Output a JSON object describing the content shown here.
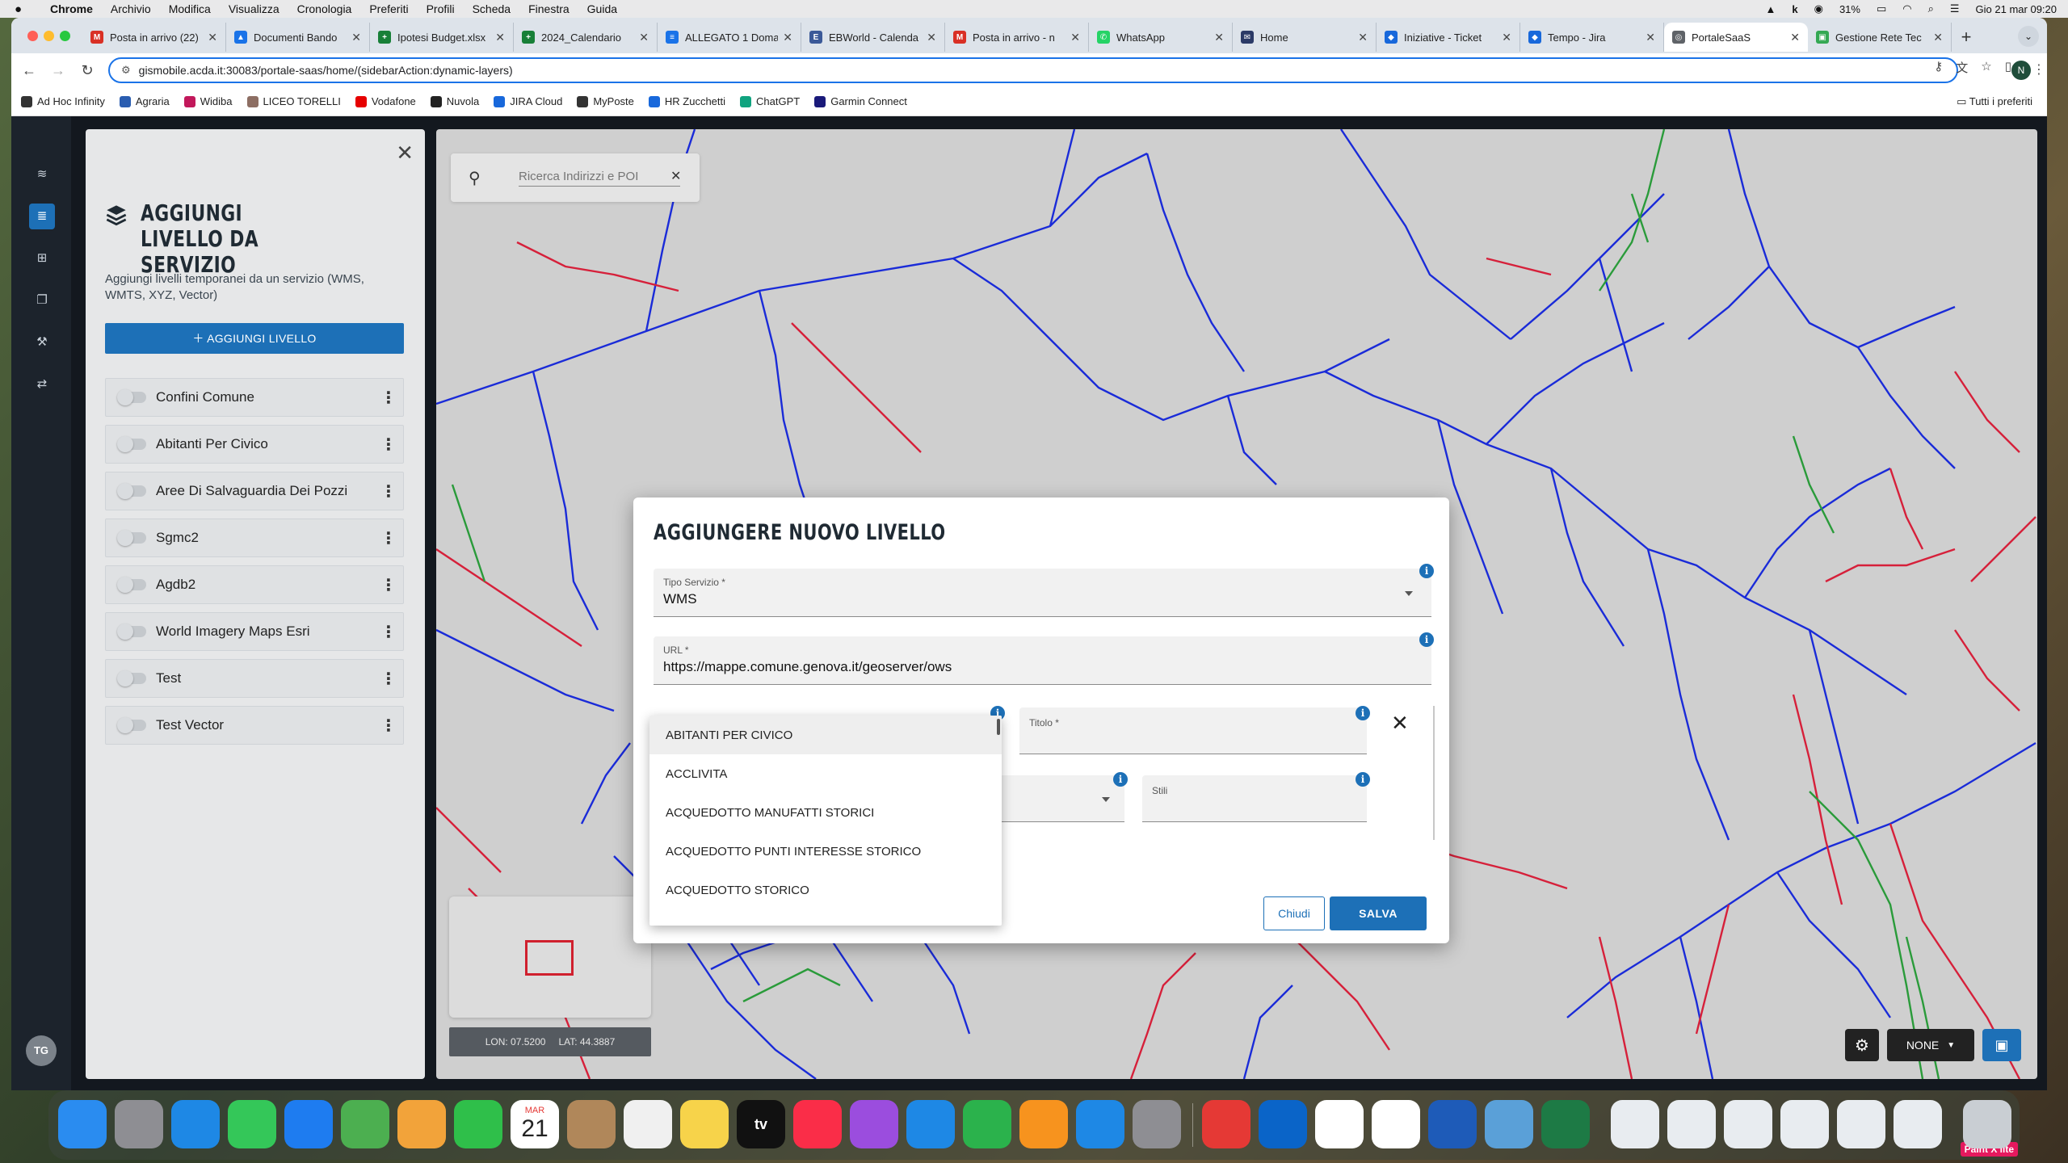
{
  "mac_menubar": {
    "app": "Chrome",
    "items": [
      "Archivio",
      "Modifica",
      "Visualizza",
      "Cronologia",
      "Preferiti",
      "Profili",
      "Scheda",
      "Finestra",
      "Guida"
    ],
    "battery": "31%",
    "datetime": "Gio 21 mar  09:20"
  },
  "browser": {
    "tabs": [
      {
        "title": "Posta in arrivo (22)",
        "color": "#d93025",
        "letter": "M"
      },
      {
        "title": "Documenti Bando",
        "color": "#1a73e8",
        "letter": "▲"
      },
      {
        "title": "Ipotesi Budget.xlsx",
        "color": "#188038",
        "letter": "+"
      },
      {
        "title": "2024_Calendario",
        "color": "#188038",
        "letter": "+"
      },
      {
        "title": "ALLEGATO 1 Doma",
        "color": "#1a73e8",
        "letter": "≡"
      },
      {
        "title": "EBWorld - Calenda",
        "color": "#3b5998",
        "letter": "E"
      },
      {
        "title": "Posta in arrivo - n",
        "color": "#d93025",
        "letter": "M"
      },
      {
        "title": "WhatsApp",
        "color": "#25d366",
        "letter": "✆"
      },
      {
        "title": "Home",
        "color": "#2b3a67",
        "letter": "✉"
      },
      {
        "title": "Iniziative - Ticket",
        "color": "#1868db",
        "letter": "◆"
      },
      {
        "title": "Tempo - Jira",
        "color": "#1868db",
        "letter": "◆"
      },
      {
        "title": "PortaleSaaS",
        "color": "#5f6368",
        "letter": "◎"
      },
      {
        "title": "Gestione Rete Tec",
        "color": "#34a853",
        "letter": "▣"
      }
    ],
    "active_tab_index": 11,
    "url": "gismobile.acda.it:30083/portale-saas/home/(sidebarAction:dynamic-layers)",
    "profile_initial": "N",
    "bookmarks": [
      {
        "label": "Ad Hoc Infinity",
        "color": "#333"
      },
      {
        "label": "Agraria",
        "color": "#2a5db0"
      },
      {
        "label": "Widiba",
        "color": "#c2185b"
      },
      {
        "label": "LICEO TORELLI",
        "color": "#8d6e63"
      },
      {
        "label": "Vodafone",
        "color": "#e60000"
      },
      {
        "label": "Nuvola",
        "color": "#222"
      },
      {
        "label": "JIRA Cloud",
        "color": "#1868db"
      },
      {
        "label": "MyPoste",
        "color": "#333"
      },
      {
        "label": "HR Zucchetti",
        "color": "#1868db"
      },
      {
        "label": "ChatGPT",
        "color": "#10a37f"
      },
      {
        "label": "Garmin Connect",
        "color": "#1a1a7a"
      }
    ],
    "all_bookmarks": "Tutti i preferiti"
  },
  "app": {
    "rail_icons": [
      "layers-outline-icon",
      "layers-icon",
      "grid-icon",
      "copy-icon",
      "wrench-icon",
      "route-icon"
    ],
    "user_initials": "TG",
    "panel": {
      "title": "AGGIUNGI LIVELLO DA SERVIZIO",
      "description": "Aggiungi livelli temporanei da un servizio (WMS, WMTS, XYZ, Vector)",
      "add_button": "AGGIUNGI LIVELLO",
      "layers": [
        "Confini Comune",
        "Abitanti Per Civico",
        "Aree Di Salvaguardia Dei Pozzi",
        "Sgmc2",
        "Agdb2",
        "World Imagery Maps Esri",
        "Test",
        "Test Vector"
      ]
    },
    "map": {
      "search_placeholder": "Ricerca Indirizzi e POI",
      "lon": "LON: 07.5200",
      "lat": "LAT: 44.3887",
      "basemap": "NONE"
    },
    "modal": {
      "title": "AGGIUNGERE NUOVO LIVELLO",
      "service_type_label": "Tipo Servizio *",
      "service_type_value": "WMS",
      "url_label": "URL *",
      "url_value": "https://mappe.comune.genova.it/geoserver/ows",
      "title_label": "Titolo *",
      "styles_label": "Stili",
      "close_button": "Chiudi",
      "save_button": "SALVA",
      "dropdown_options": [
        "ABITANTI PER CIVICO",
        "ACCLIVITA",
        "ACQUEDOTTO MANUFATTI STORICI",
        "ACQUEDOTTO PUNTI INTERESSE STORICO",
        "ACQUEDOTTO STORICO"
      ]
    }
  },
  "dock": {
    "apps": [
      {
        "name": "finder-icon",
        "color": "#2a8cf0"
      },
      {
        "name": "launchpad-icon",
        "color": "#8e8e93"
      },
      {
        "name": "safari-icon",
        "color": "#1e88e5"
      },
      {
        "name": "messages-icon",
        "color": "#34c759"
      },
      {
        "name": "mail-icon",
        "color": "#1e7cf0"
      },
      {
        "name": "maps-icon",
        "color": "#4caf50"
      },
      {
        "name": "photos-icon",
        "color": "#f2a33a"
      },
      {
        "name": "facetime-icon",
        "color": "#2fbf4a"
      },
      {
        "name": "calendar-icon",
        "color": "#ffffff"
      },
      {
        "name": "contacts-icon",
        "color": "#b0875a"
      },
      {
        "name": "reminders-icon",
        "color": "#f0f0f0"
      },
      {
        "name": "notes-icon",
        "color": "#f7d34a"
      },
      {
        "name": "tv-icon",
        "color": "#111111"
      },
      {
        "name": "music-icon",
        "color": "#fa2d48"
      },
      {
        "name": "podcasts-icon",
        "color": "#9b4dde"
      },
      {
        "name": "keynote-icon",
        "color": "#1e88e5"
      },
      {
        "name": "numbers-icon",
        "color": "#2bb24c"
      },
      {
        "name": "pages-icon",
        "color": "#f7931e"
      },
      {
        "name": "app-store-icon",
        "color": "#1e88e5"
      },
      {
        "name": "system-settings-icon",
        "color": "#8e8e93"
      },
      {
        "name": "anydesk-icon",
        "color": "#e53935"
      },
      {
        "name": "outlook-icon",
        "color": "#0a64c8"
      },
      {
        "name": "slack-icon",
        "color": "#ffffff"
      },
      {
        "name": "chrome-icon",
        "color": "#ffffff"
      },
      {
        "name": "word-icon",
        "color": "#1e5bb8"
      },
      {
        "name": "preview-icon",
        "color": "#5aa0d8"
      },
      {
        "name": "excel-icon",
        "color": "#1d7a45"
      }
    ],
    "calendar_month": "MAR",
    "calendar_day": "21",
    "tv_label": "tv",
    "badge": "Paint X lite"
  }
}
